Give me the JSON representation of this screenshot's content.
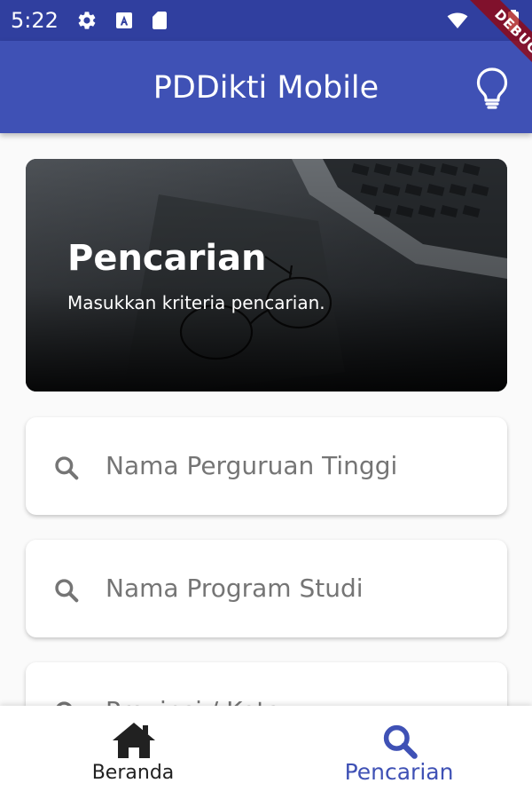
{
  "status_bar": {
    "time": "5:22",
    "background": "#303f9f",
    "left_icons": [
      "gear-icon",
      "a-notification-icon",
      "sd-card-icon"
    ],
    "right_icons": [
      "wifi-icon",
      "battery-icon"
    ]
  },
  "debug_banner": "DEBUG",
  "app_bar": {
    "title": "PDDikti Mobile",
    "background": "#3f51b5",
    "action_icon": "lightbulb-icon"
  },
  "hero": {
    "title": "Pencarian",
    "subtitle": "Masukkan kriteria pencarian."
  },
  "search_fields": [
    {
      "placeholder": "Nama Perguruan Tinggi",
      "icon": "search-icon"
    },
    {
      "placeholder": "Nama Program Studi",
      "icon": "search-icon"
    },
    {
      "placeholder": "Provinsi / Kota",
      "icon": "search-icon"
    }
  ],
  "bottom_nav": {
    "items": [
      {
        "label": "Beranda",
        "icon": "home-icon",
        "selected": false
      },
      {
        "label": "Pencarian",
        "icon": "search-icon",
        "selected": true
      }
    ],
    "active_color": "#3f51b5",
    "inactive_color": "#212121"
  }
}
